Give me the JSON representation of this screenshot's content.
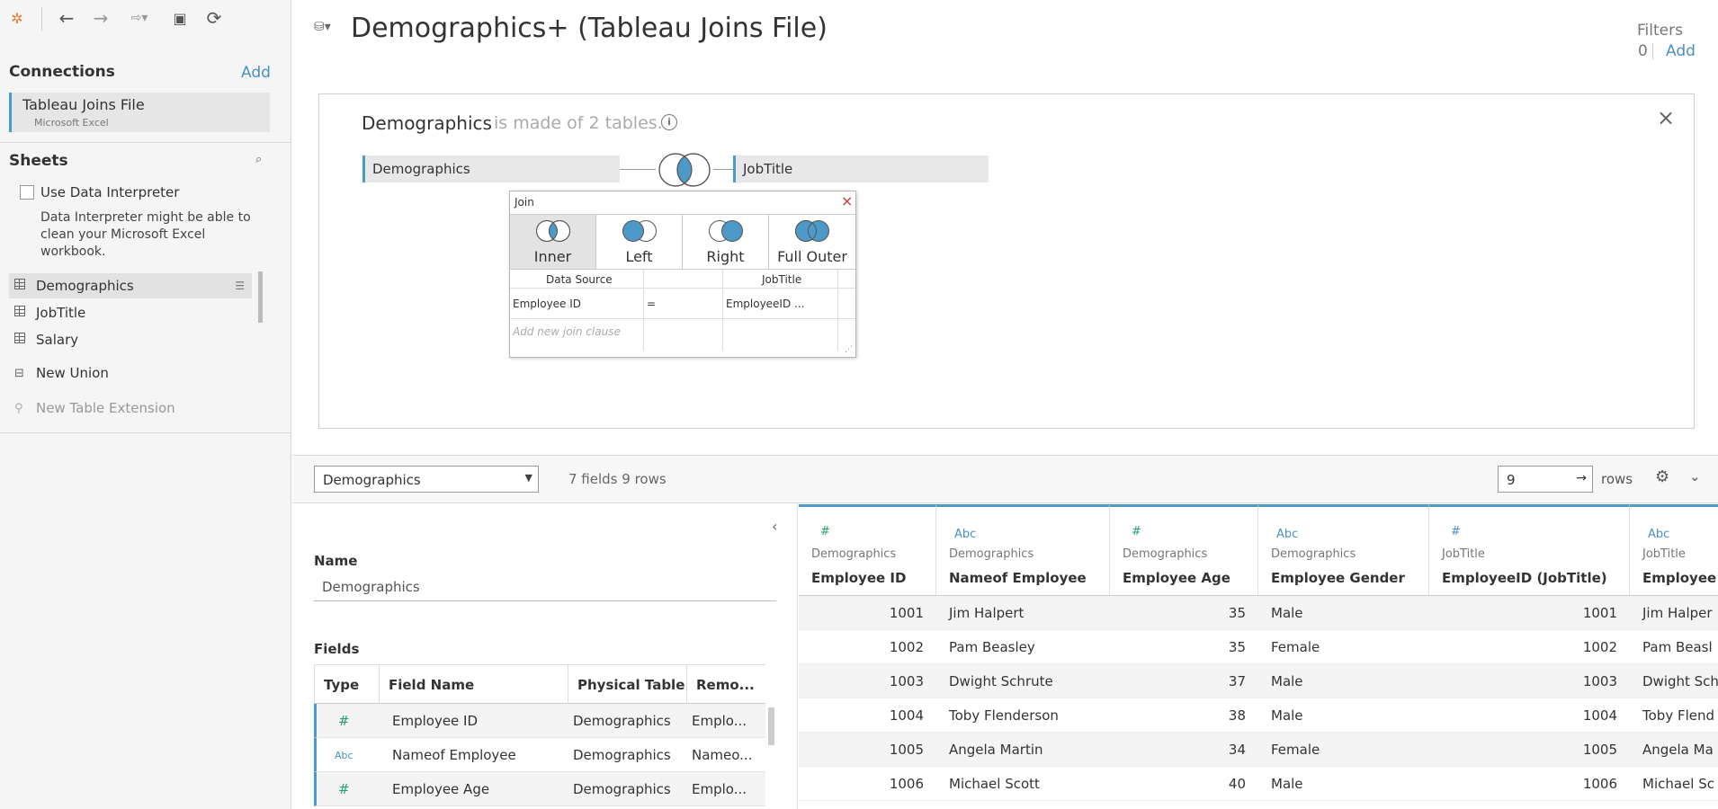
{
  "left_panel": {
    "connections_title": "Connections",
    "add_label": "Add",
    "connection": {
      "name": "Tableau Joins File",
      "type": "Microsoft Excel"
    },
    "sheets_title": "Sheets",
    "use_interpreter": "Use Data Interpreter",
    "interpreter_note": "Data Interpreter might be able to clean your Microsoft Excel workbook.",
    "sheets": [
      "Demographics",
      "JobTitle",
      "Salary"
    ],
    "new_union": "New Union",
    "new_table_extension": "New Table Extension"
  },
  "header": {
    "title": "Demographics+ (Tableau Joins File)",
    "filters_label": "Filters",
    "filters_count": "0",
    "filters_add": "Add"
  },
  "canvas": {
    "logical_table": "Demographics",
    "made_of": "is made of 2 tables.",
    "left_table": "Demographics",
    "right_table": "JobTitle"
  },
  "join": {
    "title": "Join",
    "types": [
      "Inner",
      "Left",
      "Right",
      "Full Outer"
    ],
    "left_header": "Data Source",
    "right_header": "JobTitle",
    "left_field": "Employee ID",
    "operator": "=",
    "right_field": "EmployeeID ...",
    "add_clause": "Add new join clause"
  },
  "toolbar": {
    "table_select": "Demographics",
    "summary": "7 fields 9 rows",
    "rows_value": "9",
    "rows_label": "rows"
  },
  "meta": {
    "name_label": "Name",
    "name_value": "Demographics",
    "fields_label": "Fields",
    "columns": [
      "Type",
      "Field Name",
      "Physical Table",
      "Remo..."
    ],
    "rows": [
      {
        "type": "#",
        "name": "Employee ID",
        "table": "Demographics",
        "remote": "Emplo..."
      },
      {
        "type": "Abc",
        "name": "Nameof Employee",
        "table": "Demographics",
        "remote": "Nameo..."
      },
      {
        "type": "#",
        "name": "Employee Age",
        "table": "Demographics",
        "remote": "Emplo..."
      }
    ]
  },
  "grid": {
    "columns": [
      {
        "type": "#",
        "source": "Demographics",
        "name": "Employee ID"
      },
      {
        "type": "Abc",
        "source": "Demographics",
        "name": "Nameof Employee"
      },
      {
        "type": "#",
        "source": "Demographics",
        "name": "Employee Age"
      },
      {
        "type": "Abc",
        "source": "Demographics",
        "name": "Employee Gender"
      },
      {
        "type": "#",
        "source": "JobTitle",
        "name": "EmployeeID (JobTitle)"
      },
      {
        "type": "Abc",
        "source": "JobTitle",
        "name": "Employee N"
      }
    ],
    "rows": [
      [
        "1001",
        "Jim Halpert",
        "35",
        "Male",
        "1001",
        "Jim Halper"
      ],
      [
        "1002",
        "Pam Beasley",
        "35",
        "Female",
        "1002",
        "Pam Beasl"
      ],
      [
        "1003",
        "Dwight Schrute",
        "37",
        "Male",
        "1003",
        "Dwight Sch"
      ],
      [
        "1004",
        "Toby Flenderson",
        "38",
        "Male",
        "1004",
        "Toby Flend"
      ],
      [
        "1005",
        "Angela Martin",
        "34",
        "Female",
        "1005",
        "Angela Ma"
      ],
      [
        "1006",
        "Michael Scott",
        "40",
        "Male",
        "1006",
        "Michael Sc"
      ]
    ]
  },
  "colors": {
    "accent": "#4d9ac9",
    "number_type": "#2ba06e",
    "text_type": "#4a90c2"
  }
}
